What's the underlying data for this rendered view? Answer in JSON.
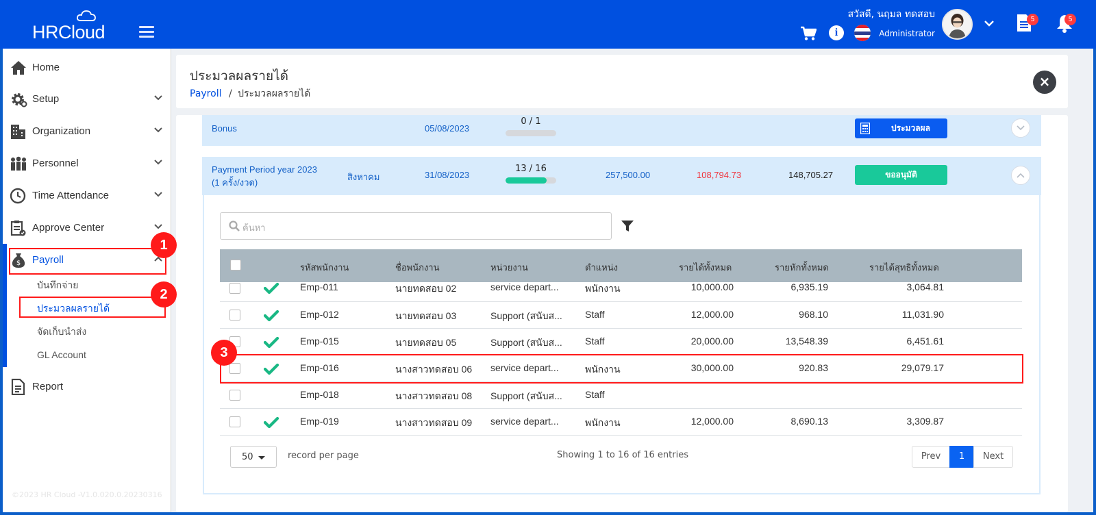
{
  "app": {
    "name": "HRCloud"
  },
  "header": {
    "greeting": "สวัสดี, นฤมล ทดสอบ",
    "role": "Administrator",
    "doc_badge": "5",
    "bell_badge": "5"
  },
  "sidebar": {
    "items": [
      {
        "label": "Home"
      },
      {
        "label": "Setup"
      },
      {
        "label": "Organization"
      },
      {
        "label": "Personnel"
      },
      {
        "label": "Time Attendance"
      },
      {
        "label": "Approve Center"
      },
      {
        "label": "Payroll"
      },
      {
        "label": "Report"
      }
    ],
    "payroll_sub": [
      {
        "label": "บันทึกจ่าย"
      },
      {
        "label": "ประมวลผลรายได้"
      },
      {
        "label": "จัดเก็บนำส่ง"
      },
      {
        "label": "GL Account"
      }
    ],
    "copyright": "©2023 HR Cloud -V1.0.020.0.20230316"
  },
  "annotations": [
    "1",
    "2",
    "3"
  ],
  "page": {
    "title": "ประมวลผลรายได้",
    "breadcrumb_root": "Payroll",
    "breadcrumb_sep": "/",
    "breadcrumb_current": "ประมวลผลรายได้"
  },
  "periods": [
    {
      "name": "Bonus",
      "date": "05/08/2023",
      "progress_label": "0 / 1",
      "progress": 0,
      "button": "ประมวลผล"
    },
    {
      "name_line1": "Payment Period year 2023",
      "name_line2": "(1 ครั้ง/งวด)",
      "month": "สิงหาคม",
      "date": "31/08/2023",
      "progress_label": "13 / 16",
      "progress": 0.8125,
      "income": "257,500.00",
      "deduction": "108,794.73",
      "net": "148,705.27",
      "button": "ขออนุมัติ"
    }
  ],
  "search": {
    "placeholder": "ค้นหา"
  },
  "table": {
    "headers": [
      "รหัสพนักงาน",
      "ชื่อพนักงาน",
      "หน่วยงาน",
      "ตำแหน่ง",
      "รายได้ทั้งหมด",
      "รายหักทั้งหมด",
      "รายได้สุทธิทั้งหมด"
    ],
    "rows": [
      {
        "id": "Emp-011",
        "name": "นายทดสอบ 02",
        "dept": "service depart...",
        "pos": "พนักงาน",
        "income": "10,000.00",
        "deduct": "6,935.19",
        "net": "3,064.81",
        "done": true
      },
      {
        "id": "Emp-012",
        "name": "นายทดสอบ 03",
        "dept": "Support (สนับส...",
        "pos": "Staff",
        "income": "12,000.00",
        "deduct": "968.10",
        "net": "11,031.90",
        "done": true
      },
      {
        "id": "Emp-015",
        "name": "นายทดสอบ 05",
        "dept": "Support (สนับส...",
        "pos": "Staff",
        "income": "20,000.00",
        "deduct": "13,548.39",
        "net": "6,451.61",
        "done": true
      },
      {
        "id": "Emp-016",
        "name": "นางสาวทดสอบ 06",
        "dept": "service depart...",
        "pos": "พนักงาน",
        "income": "30,000.00",
        "deduct": "920.83",
        "net": "29,079.17",
        "done": true
      },
      {
        "id": "Emp-018",
        "name": "นางสาวทดสอบ 08",
        "dept": "Support (สนับส...",
        "pos": "Staff",
        "income": "",
        "deduct": "",
        "net": "",
        "done": false
      },
      {
        "id": "Emp-019",
        "name": "นางสาวทดสอบ 09",
        "dept": "service depart...",
        "pos": "พนักงาน",
        "income": "12,000.00",
        "deduct": "8,690.13",
        "net": "3,309.87",
        "done": true
      }
    ]
  },
  "pagination": {
    "page_size": "50",
    "per_page_label": "record per page",
    "showing": "Showing 1 to 16 of 16 entries",
    "prev": "Prev",
    "current": "1",
    "next": "Next"
  }
}
